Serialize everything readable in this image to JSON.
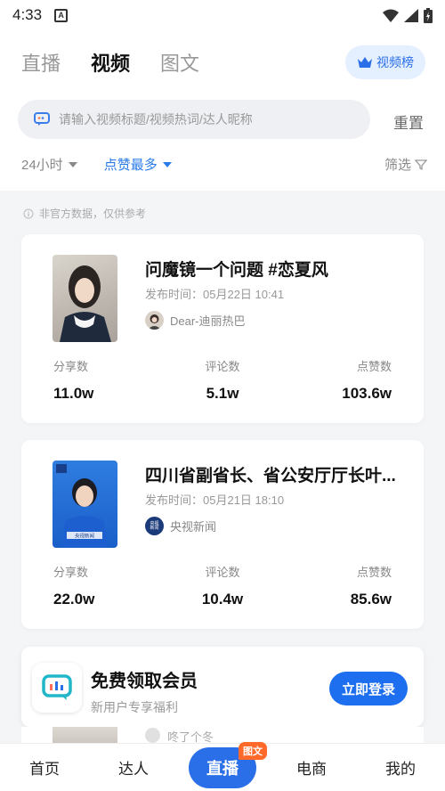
{
  "status_bar": {
    "time": "4:33",
    "notification_icon": "A"
  },
  "tabs": [
    {
      "label": "直播"
    },
    {
      "label": "视频"
    },
    {
      "label": "图文"
    }
  ],
  "rank_button": {
    "label": "视频榜"
  },
  "search": {
    "placeholder": "请输入视频标题/视频热词/达人昵称",
    "reset_label": "重置"
  },
  "filters": {
    "time_range": "24小时",
    "sort": "点赞最多",
    "filter_label": "筛选"
  },
  "notice": "非官方数据，仅供参考",
  "videos": [
    {
      "title": "问魔镜一个问题 #恋夏风",
      "publish_time": "发布时间：05月22日 10:41",
      "author": "Dear-迪丽热巴",
      "stats": [
        {
          "label": "分享数",
          "value": "11.0w"
        },
        {
          "label": "评论数",
          "value": "5.1w"
        },
        {
          "label": "点赞数",
          "value": "103.6w"
        }
      ]
    },
    {
      "title": "四川省副省长、省公安厅厅长叶...",
      "publish_time": "发布时间：05月21日 18:10",
      "author": "央视新闻",
      "author_avatar_text": "央视新闻",
      "thumb_caption": "央视新闻",
      "stats": [
        {
          "label": "分享数",
          "value": "22.0w"
        },
        {
          "label": "评论数",
          "value": "10.4w"
        },
        {
          "label": "点赞数",
          "value": "85.6w"
        }
      ]
    }
  ],
  "promo": {
    "title": "免费领取会员",
    "subtitle": "新用户专享福利",
    "button": "立即登录"
  },
  "peek_item": {
    "author": "咚了个冬"
  },
  "bottom_nav": [
    {
      "label": "首页"
    },
    {
      "label": "达人"
    },
    {
      "label": "直播",
      "badge": "图文"
    },
    {
      "label": "电商"
    },
    {
      "label": "我的"
    }
  ],
  "colors": {
    "accent": "#2a6fe8",
    "badge": "#ff6a2a"
  }
}
